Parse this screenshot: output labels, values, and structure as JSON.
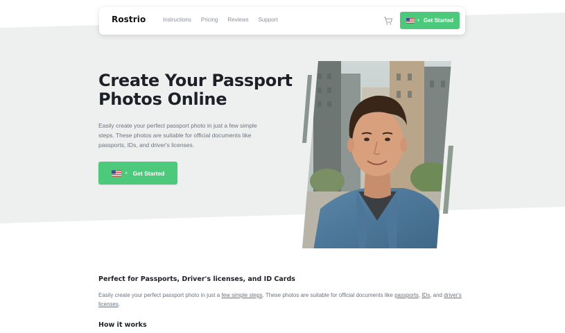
{
  "header": {
    "brand": "Rostrio",
    "nav": [
      "Instructions",
      "Pricing",
      "Reviews",
      "Support"
    ],
    "cta_label": "Get Started",
    "cart_icon": "cart-icon",
    "flag_icon": "us-flag-icon"
  },
  "hero": {
    "title_line1": "Create Your Passport",
    "title_line2": "Photos Online",
    "description": "Easily create your perfect passport photo in just a few simple steps. These photos are suitable for official documents like passports, IDs, and driver's licenses.",
    "cta_label": "Get Started"
  },
  "section": {
    "title": "Perfect for Passports, Driver's licenses, and ID Cards",
    "text_part1": "Easily create your perfect passport photo in just a ",
    "link_steps": "few simple steps",
    "text_part2": ". These photos are suitable for official documents like ",
    "link_passports": "passports",
    "text_part3": ", ",
    "link_ids": "IDs",
    "text_part4": ", and ",
    "link_licenses": "driver's licenses",
    "text_part5": ".",
    "how_title": "How it works"
  },
  "colors": {
    "accent": "#4cc97a",
    "hero_bg": "#eef0ef",
    "text_dark": "#1d2127",
    "text_muted": "#6b7280"
  }
}
